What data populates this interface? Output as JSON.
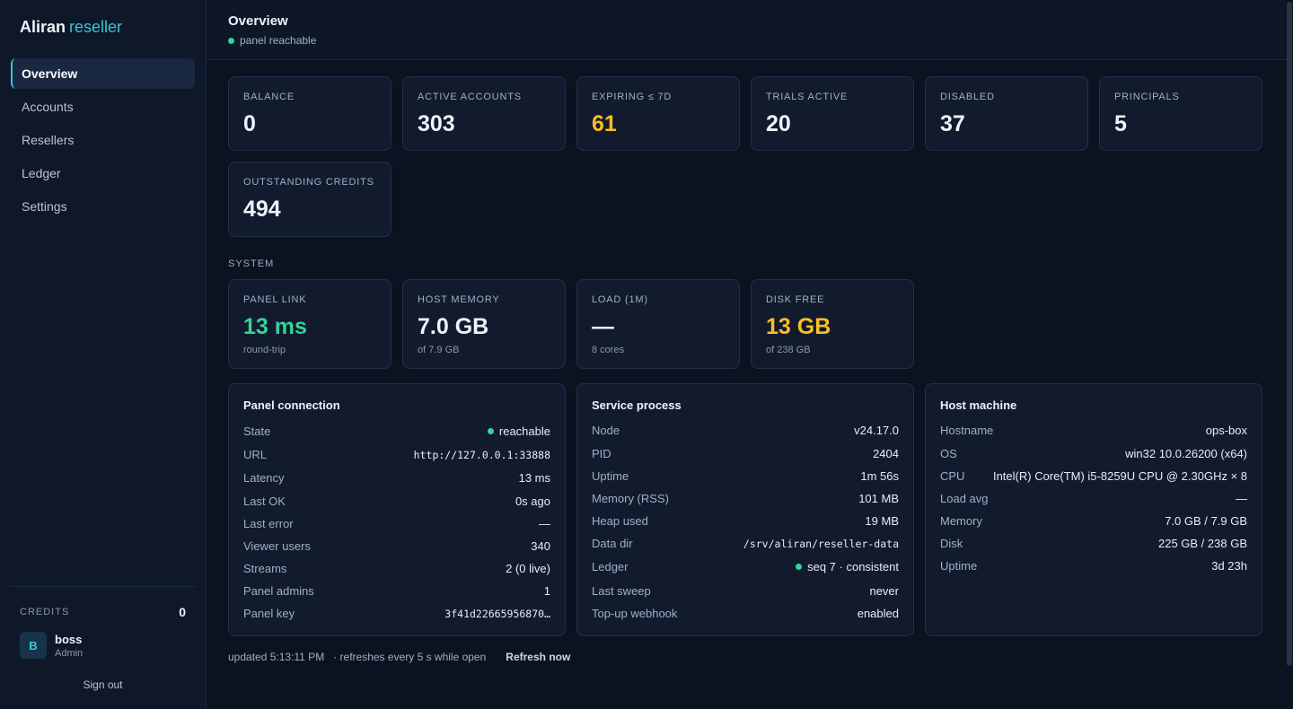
{
  "brand": {
    "name": "Aliran",
    "suffix": "reseller"
  },
  "nav": [
    "Overview",
    "Accounts",
    "Resellers",
    "Ledger",
    "Settings"
  ],
  "sidebar_footer": {
    "credits_label": "CREDITS",
    "credits_value": "0",
    "avatar_initial": "B",
    "user_name": "boss",
    "user_role": "Admin",
    "signout_label": "Sign out"
  },
  "header": {
    "title": "Overview",
    "status": "panel reachable"
  },
  "stats": [
    {
      "label": "BALANCE",
      "value": "0"
    },
    {
      "label": "ACTIVE ACCOUNTS",
      "value": "303"
    },
    {
      "label": "EXPIRING ≤ 7D",
      "value": "61"
    },
    {
      "label": "TRIALS ACTIVE",
      "value": "20"
    },
    {
      "label": "DISABLED",
      "value": "37"
    },
    {
      "label": "PRINCIPALS",
      "value": "5"
    },
    {
      "label": "OUTSTANDING CREDITS",
      "value": "494"
    }
  ],
  "system_label": "SYSTEM",
  "system": [
    {
      "label": "PANEL LINK",
      "value": "13 ms",
      "sub": "round-trip"
    },
    {
      "label": "HOST MEMORY",
      "value": "7.0 GB",
      "sub": "of 7.9 GB"
    },
    {
      "label": "LOAD (1M)",
      "value": "—",
      "sub": "8 cores"
    },
    {
      "label": "DISK FREE",
      "value": "13 GB",
      "sub": "of 238 GB"
    }
  ],
  "panel_connection": {
    "title": "Panel connection",
    "rows": [
      {
        "k": "State",
        "v": "reachable"
      },
      {
        "k": "URL",
        "v": "http://127.0.0.1:33888"
      },
      {
        "k": "Latency",
        "v": "13 ms"
      },
      {
        "k": "Last OK",
        "v": "0s ago"
      },
      {
        "k": "Last error",
        "v": "—"
      },
      {
        "k": "Viewer users",
        "v": "340"
      },
      {
        "k": "Streams",
        "v": "2 (0 live)"
      },
      {
        "k": "Panel admins",
        "v": "1"
      },
      {
        "k": "Panel key",
        "v": "3f41d22665956870…"
      }
    ]
  },
  "service_process": {
    "title": "Service process",
    "rows": [
      {
        "k": "Node",
        "v": "v24.17.0"
      },
      {
        "k": "PID",
        "v": "2404"
      },
      {
        "k": "Uptime",
        "v": "1m 56s"
      },
      {
        "k": "Memory (RSS)",
        "v": "101 MB"
      },
      {
        "k": "Heap used",
        "v": "19 MB"
      },
      {
        "k": "Data dir",
        "v": "/srv/aliran/reseller-data"
      },
      {
        "k": "Ledger",
        "v": "seq 7 · consistent"
      },
      {
        "k": "Last sweep",
        "v": "never"
      },
      {
        "k": "Top-up webhook",
        "v": "enabled"
      }
    ]
  },
  "host_machine": {
    "title": "Host machine",
    "rows": [
      {
        "k": "Hostname",
        "v": "ops-box"
      },
      {
        "k": "OS",
        "v": "win32 10.0.26200 (x64)"
      },
      {
        "k": "CPU",
        "v": "Intel(R) Core(TM) i5-8259U CPU @ 2.30GHz × 8"
      },
      {
        "k": "Load avg",
        "v": "—"
      },
      {
        "k": "Memory",
        "v": "7.0 GB / 7.9 GB"
      },
      {
        "k": "Disk",
        "v": "225 GB / 238 GB"
      },
      {
        "k": "Uptime",
        "v": "3d 23h"
      }
    ]
  },
  "footer": {
    "updated": "updated 5:13:11 PM",
    "refresh_note": "· refreshes every 5 s while open",
    "refresh_button": "Refresh now"
  },
  "colors": {
    "accent": "#38c4d6",
    "ok": "#34d399",
    "warn": "#fbbf24",
    "background": "#0b1220"
  }
}
